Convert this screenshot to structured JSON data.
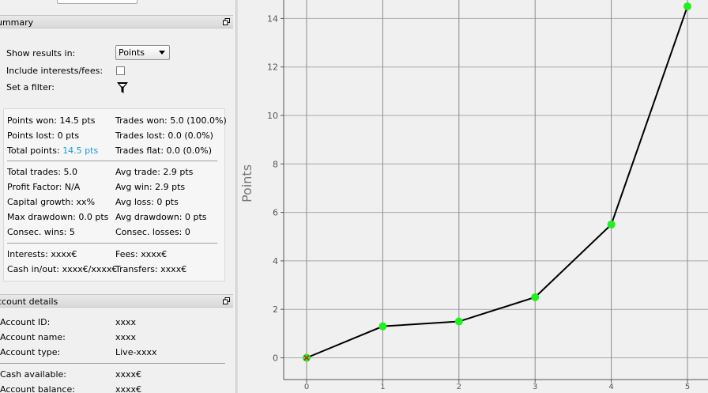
{
  "summary": {
    "title": "ummary",
    "show_results_label": "Show results in:",
    "show_results_value": "Points",
    "include_interests_label": "Include interests/fees:",
    "include_interests_checked": false,
    "filter_label": "Set a filter:",
    "filter_icon": "funnel-icon",
    "stats": {
      "points_won": "Points won: 14.5 pts",
      "points_lost": "Points lost: 0 pts",
      "total_points_label": "Total points: ",
      "total_points_value": "14.5 pts",
      "trades_won": "Trades won: 5.0 (100.0%)",
      "trades_lost": "Trades lost: 0.0 (0.0%)",
      "trades_flat": "Trades flat: 0.0 (0.0%)",
      "total_trades": "Total trades: 5.0",
      "profit_factor": "Profit Factor: N/A",
      "capital_growth": "Capital growth: xx%",
      "max_drawdown": "Max drawdown: 0.0 pts",
      "consec_wins": "Consec. wins: 5",
      "avg_trade": "Avg trade: 2.9 pts",
      "avg_win": "Avg win: 2.9 pts",
      "avg_loss": "Avg loss: 0 pts",
      "avg_drawdown": "Avg drawdown: 0 pts",
      "consec_losses": "Consec. losses: 0",
      "interests": "Interests: xxxx€",
      "cash_in_out": "Cash in/out: xxxx€/xxxx€",
      "fees": "Fees: xxxx€",
      "transfers": "Transfers: xxxx€"
    }
  },
  "account": {
    "title": "ccount details",
    "rows": [
      {
        "label": "Account ID:",
        "value": "xxxx"
      },
      {
        "label": "Account name:",
        "value": "xxxx"
      },
      {
        "label": "Account type:",
        "value": "Live-xxxx"
      },
      {
        "label": "Cash available:",
        "value": "xxxx€"
      },
      {
        "label": "Account balance:",
        "value": "xxxx€"
      }
    ]
  },
  "colors": {
    "accent": "#1a9bd7",
    "marker": "#1ff01f",
    "start_cross": "#d42020"
  },
  "chart_data": {
    "type": "line",
    "x": [
      0,
      1,
      2,
      3,
      4,
      5
    ],
    "series": [
      {
        "values": [
          0,
          1.3,
          1.5,
          2.5,
          5.5,
          14.5
        ]
      }
    ],
    "ylabel": "Points",
    "xlabel": "",
    "xlim": [
      0,
      5
    ],
    "ylim": [
      -0.5,
      14.5
    ],
    "x_ticks": [
      "0",
      "1",
      "2",
      "3",
      "4",
      "5"
    ],
    "y_ticks": [
      "0",
      "2",
      "4",
      "6",
      "8",
      "10",
      "12",
      "14"
    ],
    "grid": true
  }
}
